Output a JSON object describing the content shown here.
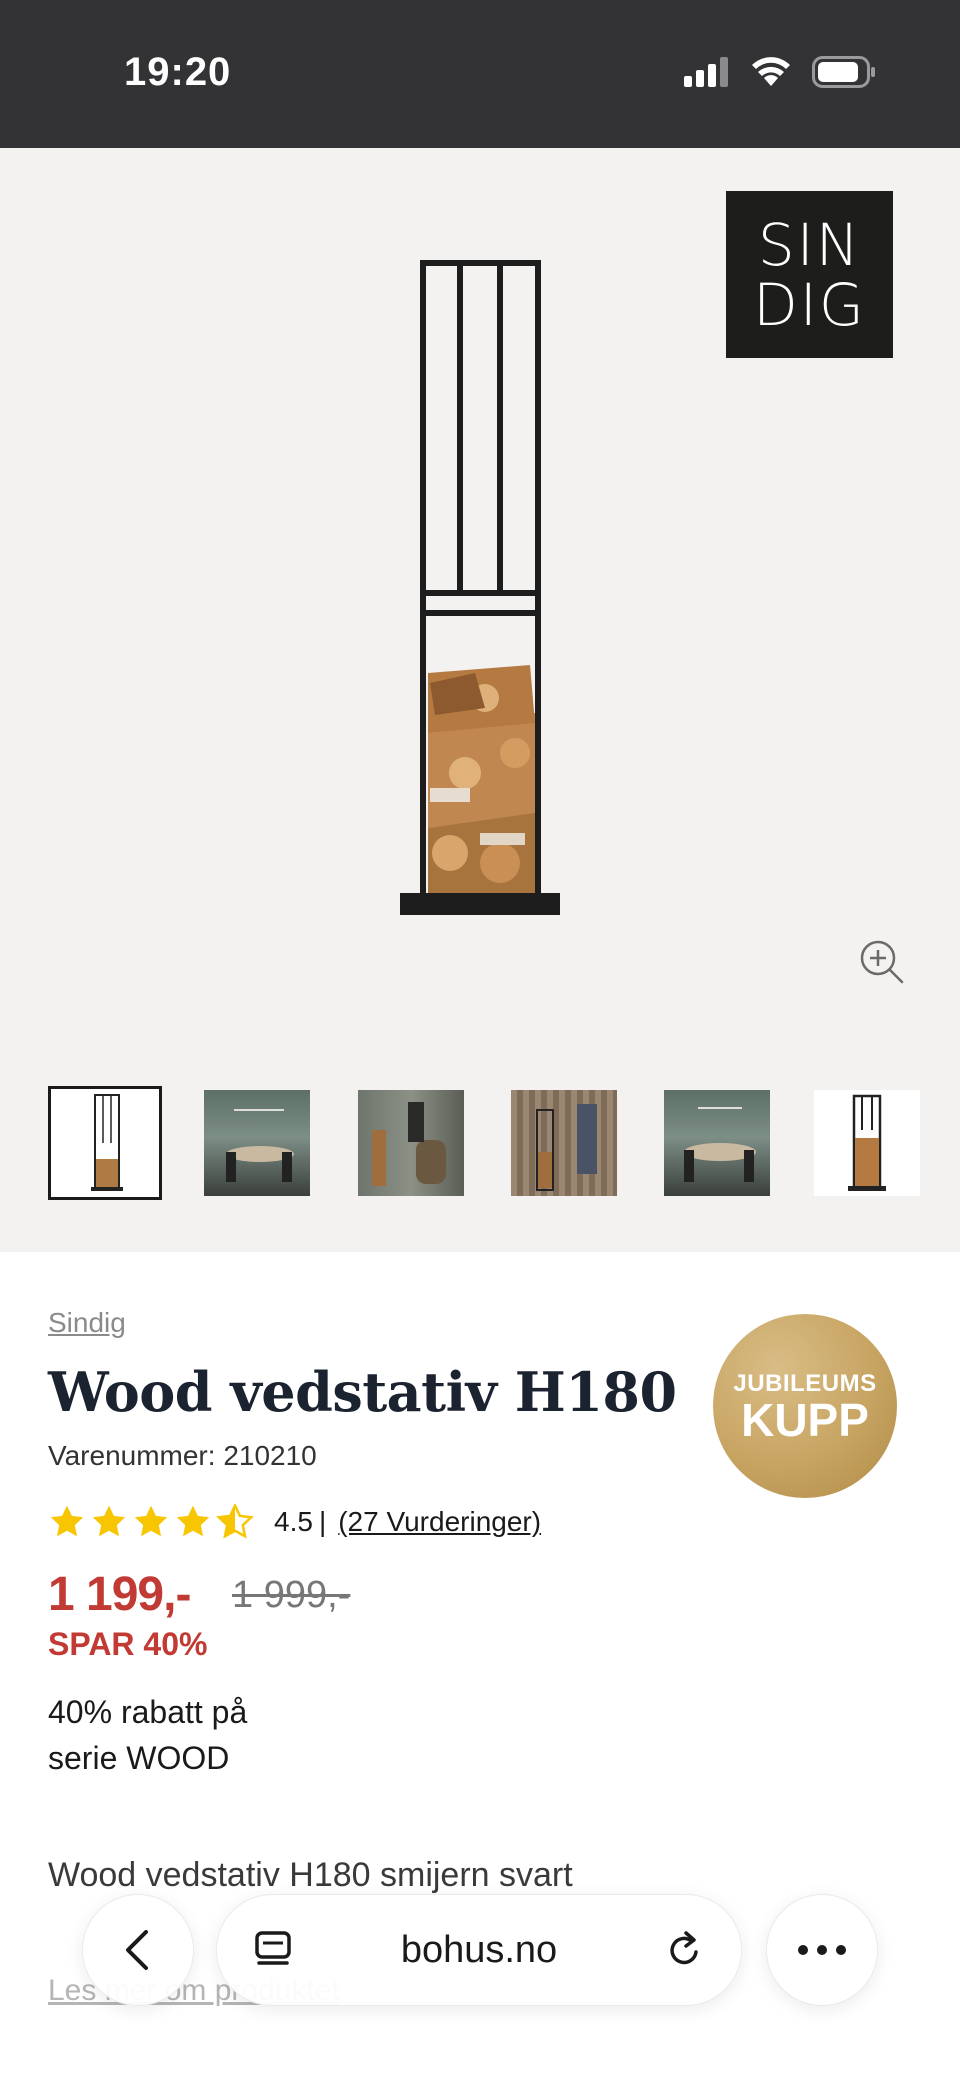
{
  "status_bar": {
    "time": "19:20"
  },
  "hero": {
    "brand_logo_top": "SIN",
    "brand_logo_bottom": "DIG",
    "thumbnails": [
      {
        "name": "thumbnail-1"
      },
      {
        "name": "thumbnail-2"
      },
      {
        "name": "thumbnail-3"
      },
      {
        "name": "thumbnail-4"
      },
      {
        "name": "thumbnail-5"
      },
      {
        "name": "thumbnail-6"
      }
    ]
  },
  "product": {
    "brand": "Sindig",
    "title": "Wood vedstativ H180",
    "sku": "Varenummer: 210210",
    "rating_value": "4.5",
    "rating_separator": "|",
    "rating_count": "(27 Vurderinger)",
    "rating_stars": 4.5,
    "price": "1 199,-",
    "old_price": "1 999,-",
    "save_text": "SPAR 40%",
    "promo_line1": "40% rabatt på",
    "promo_line2": "serie WOOD",
    "description": "Wood vedstativ H180 smijern svart",
    "read_more": "Les mer om produktet"
  },
  "badge": {
    "line1": "JUBILEUMS",
    "line2": "KUPP",
    "color": "#c7a462"
  },
  "toolbar": {
    "url": "bohus.no"
  },
  "colors": {
    "accent_red": "#c13a33",
    "star_yellow": "#f7c600",
    "status_bar_bg": "#333336",
    "hero_bg": "#f4f2f0"
  }
}
